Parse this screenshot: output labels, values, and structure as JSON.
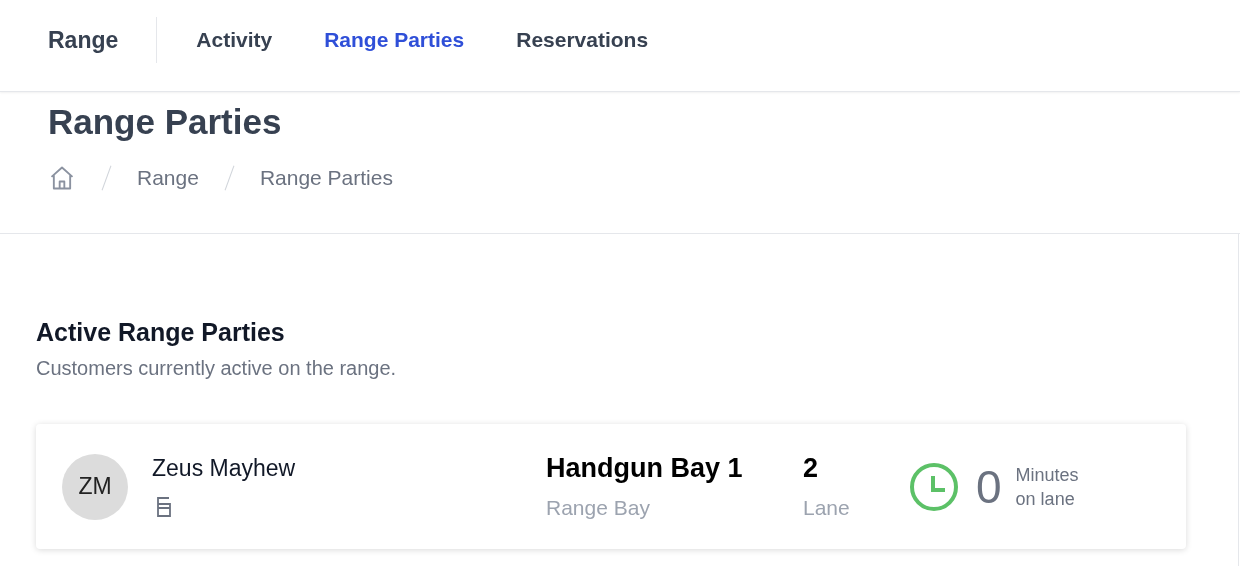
{
  "nav": {
    "brand": "Range",
    "tabs": [
      {
        "label": "Activity",
        "selected": false
      },
      {
        "label": "Range Parties",
        "selected": true
      },
      {
        "label": "Reservations",
        "selected": false
      }
    ]
  },
  "page_title": "Range Parties",
  "breadcrumb": [
    "Range",
    "Range Parties"
  ],
  "section": {
    "title": "Active Range Parties",
    "subtitle": "Customers currently active on the range."
  },
  "parties": [
    {
      "initials": "ZM",
      "name": "Zeus Mayhew",
      "bay": "Handgun Bay 1",
      "bay_label": "Range Bay",
      "lane": "2",
      "lane_label": "Lane",
      "minutes": "0",
      "minutes_label": "Minutes on lane"
    }
  ]
}
